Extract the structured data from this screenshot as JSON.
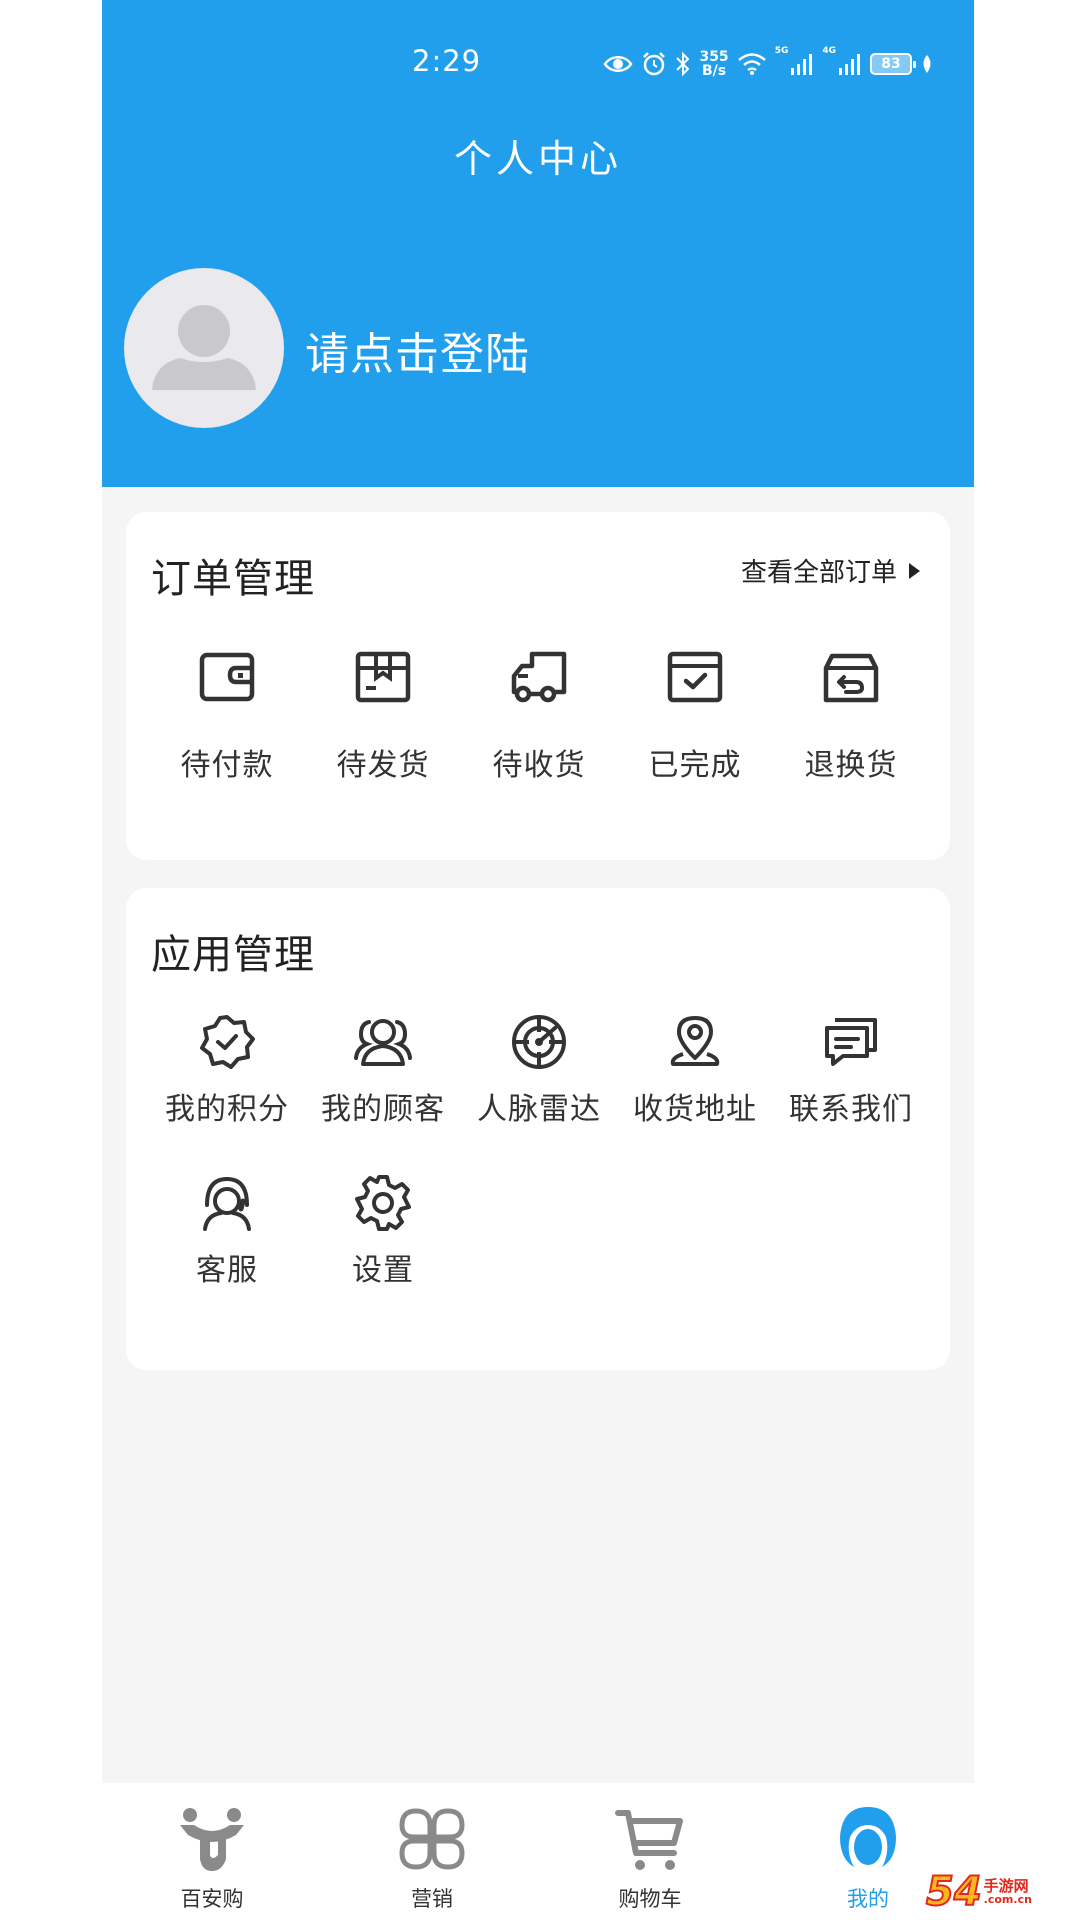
{
  "status_bar": {
    "time": "2:29",
    "net_speed_value": "355",
    "net_speed_unit": "B/s",
    "sim1_tag": "5G",
    "sim2_tag": "4G",
    "battery": "83"
  },
  "header": {
    "title": "个人中心",
    "login_prompt": "请点击登陆"
  },
  "orders": {
    "title": "订单管理",
    "view_all": "查看全部订单",
    "items": [
      {
        "label": "待付款",
        "icon": "wallet-icon"
      },
      {
        "label": "待发货",
        "icon": "package-icon"
      },
      {
        "label": "待收货",
        "icon": "truck-icon"
      },
      {
        "label": "已完成",
        "icon": "completed-box-icon"
      },
      {
        "label": "退换货",
        "icon": "return-box-icon"
      }
    ]
  },
  "apps": {
    "title": "应用管理",
    "items": [
      {
        "label": "我的积分",
        "icon": "badge-check-icon"
      },
      {
        "label": "我的顾客",
        "icon": "customers-icon"
      },
      {
        "label": "人脉雷达",
        "icon": "radar-icon"
      },
      {
        "label": "收货地址",
        "icon": "location-pin-icon"
      },
      {
        "label": "联系我们",
        "icon": "message-icon"
      },
      {
        "label": "客服",
        "icon": "headset-icon"
      },
      {
        "label": "设置",
        "icon": "gear-icon"
      }
    ]
  },
  "tabbar": {
    "items": [
      {
        "label": "百安购",
        "icon": "home-logo-icon",
        "active": false
      },
      {
        "label": "营销",
        "icon": "clover-icon",
        "active": false
      },
      {
        "label": "购物车",
        "icon": "cart-icon",
        "active": false
      },
      {
        "label": "我的",
        "icon": "profile-icon",
        "active": true
      }
    ]
  },
  "colors": {
    "brand_blue": "#229fec",
    "background": "#f5f5f5",
    "icon_dark": "#333333",
    "tab_gray": "#8a8a8a"
  },
  "watermark": {
    "number": "54",
    "text_cn": "手游网",
    "text_domain": ".com.cn"
  }
}
